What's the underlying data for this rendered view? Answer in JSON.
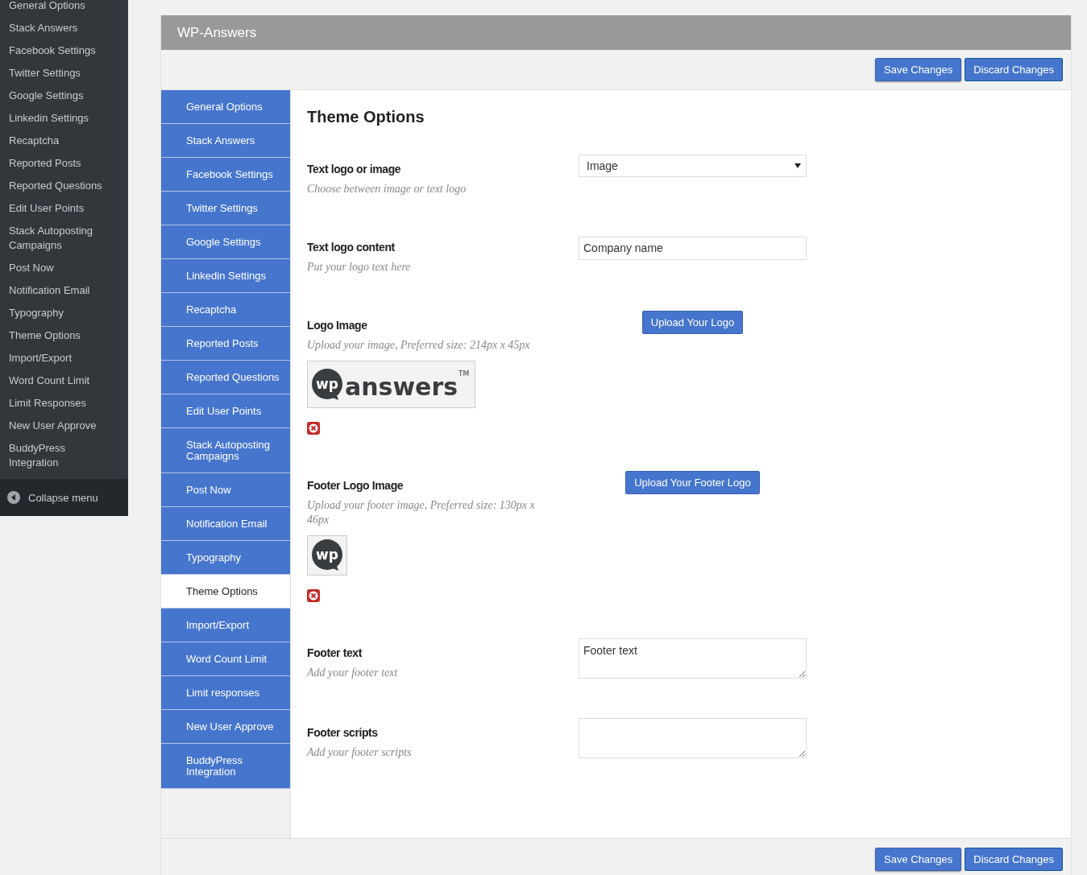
{
  "admin_menu": {
    "items": [
      {
        "label": "General Options"
      },
      {
        "label": "Stack Answers"
      },
      {
        "label": "Facebook Settings"
      },
      {
        "label": "Twitter Settings"
      },
      {
        "label": "Google Settings"
      },
      {
        "label": "Linkedin Settings"
      },
      {
        "label": "Recaptcha"
      },
      {
        "label": "Reported Posts"
      },
      {
        "label": "Reported Questions"
      },
      {
        "label": "Edit User Points"
      },
      {
        "label": "Stack Autoposting Campaigns"
      },
      {
        "label": "Post Now"
      },
      {
        "label": "Notification Email"
      },
      {
        "label": "Typography"
      },
      {
        "label": "Theme Options"
      },
      {
        "label": "Import/Export"
      },
      {
        "label": "Word Count Limit"
      },
      {
        "label": "Limit Responses"
      },
      {
        "label": "New User Approve"
      },
      {
        "label": "BuddyPress Integration"
      }
    ],
    "collapse": "Collapse menu"
  },
  "panel": {
    "title": "WP-Answers",
    "buttons": [
      "Save Changes",
      "Discard Changes"
    ],
    "tabs": [
      {
        "label": "General Options",
        "selected": false
      },
      {
        "label": "Stack Answers",
        "selected": false
      },
      {
        "label": "Facebook Settings",
        "selected": false
      },
      {
        "label": "Twitter Settings",
        "selected": false
      },
      {
        "label": "Google Settings",
        "selected": false
      },
      {
        "label": "Linkedin Settings",
        "selected": false
      },
      {
        "label": "Recaptcha",
        "selected": false
      },
      {
        "label": "Reported Posts",
        "selected": false
      },
      {
        "label": "Reported Questions",
        "selected": false
      },
      {
        "label": "Edit User Points",
        "selected": false
      },
      {
        "label": "Stack Autoposting Campaigns",
        "selected": false
      },
      {
        "label": "Post Now",
        "selected": false
      },
      {
        "label": "Notification Email",
        "selected": false
      },
      {
        "label": "Typography",
        "selected": false
      },
      {
        "label": "Theme Options",
        "selected": true
      },
      {
        "label": "Import/Export",
        "selected": false
      },
      {
        "label": "Word Count Limit",
        "selected": false
      },
      {
        "label": "Limit responses",
        "selected": false
      },
      {
        "label": "New User Approve",
        "selected": false
      },
      {
        "label": "BuddyPress Integration",
        "selected": false
      }
    ],
    "footer_buttons": [
      "Save Changes",
      "Discard Changes"
    ],
    "heading": "Theme Options",
    "fields": [
      {
        "kind": "select",
        "label": "Text logo or image",
        "description": "Choose between image or text logo",
        "value": "Image"
      },
      {
        "kind": "text",
        "label": "Text logo content",
        "description": "Put your logo text here",
        "value": "Company name"
      },
      {
        "kind": "upload",
        "label": "Logo Image",
        "description": "Upload your image, Preferred size: 214px x 45px",
        "button": "Upload Your Logo",
        "preview": {
          "mark": "wp",
          "word": "answers",
          "tm": "TM"
        }
      },
      {
        "kind": "upload",
        "label": "Footer Logo Image",
        "description": "Upload your footer image, Preferred size: 130px x 46px",
        "button": "Upload Your Footer Logo",
        "preview": {
          "mark": "wp"
        }
      },
      {
        "kind": "textarea",
        "label": "Footer text",
        "description": "Add your footer text",
        "value": "Footer text"
      },
      {
        "kind": "textarea",
        "label": "Footer scripts",
        "description": "Add your footer scripts"
      }
    ]
  }
}
